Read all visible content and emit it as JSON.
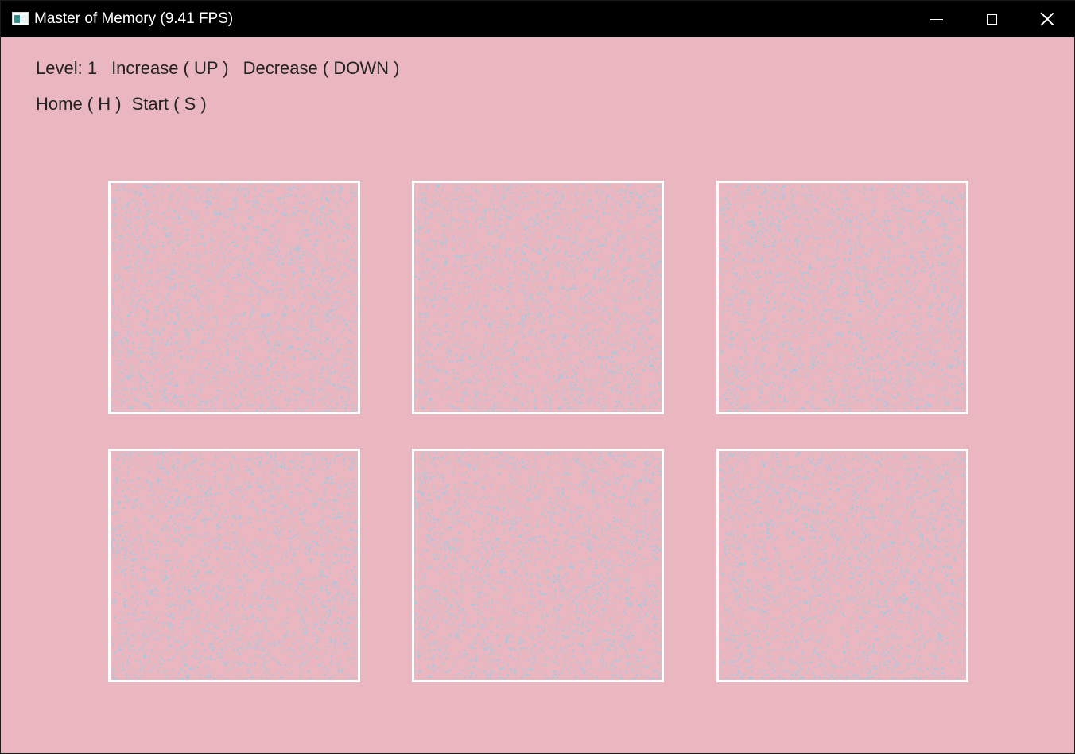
{
  "window": {
    "title": "Master of Memory (9.41 FPS)",
    "icon": "app-window-icon",
    "controls": {
      "minimize_icon": "minimize-icon",
      "maximize_icon": "maximize-icon",
      "close_icon": "close-icon"
    }
  },
  "hud": {
    "level_label": "Level: 1",
    "increase_label": "Increase ( UP )",
    "decrease_label": "Decrease ( DOWN )",
    "home_label": "Home ( H )",
    "start_label": "Start ( S )"
  },
  "board": {
    "card_count": 6,
    "colors": {
      "background": "#eab7c0",
      "card_border": "#ffffff",
      "dots": "#9ccbe3"
    }
  }
}
